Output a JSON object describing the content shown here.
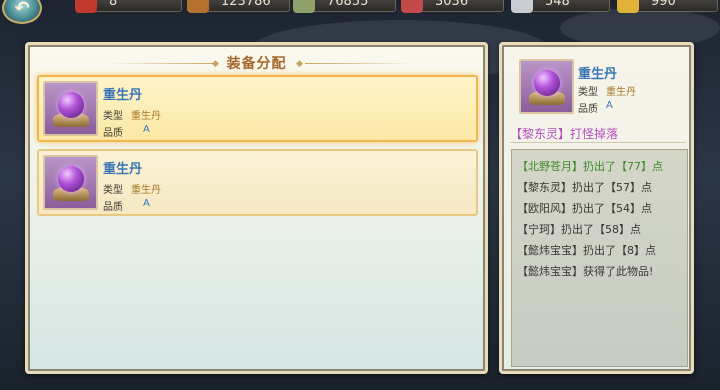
{
  "resources": [
    {
      "icon": "flame-token-icon",
      "value": "8",
      "color": "#c0392b"
    },
    {
      "icon": "wood-icon",
      "value": "123786",
      "color": "#b5722e"
    },
    {
      "icon": "cash-icon",
      "value": "76855",
      "color": "#8fa06a"
    },
    {
      "icon": "meat-icon",
      "value": "3036",
      "color": "#c44a4a"
    },
    {
      "icon": "silver-icon",
      "value": "548",
      "color": "#c9ccd0"
    },
    {
      "icon": "gold-icon",
      "value": "990",
      "color": "#e0b23a"
    }
  ],
  "back_button": {
    "glyph": "↶"
  },
  "panel": {
    "title": "装备分配"
  },
  "items": [
    {
      "name": "重生丹",
      "type_label": "类型",
      "type_value": "重生丹",
      "quality_label": "品质",
      "quality_value": "A"
    },
    {
      "name": "重生丹",
      "type_label": "类型",
      "type_value": "重生丹",
      "quality_label": "品质",
      "quality_value": "A"
    }
  ],
  "detail": {
    "name": "重生丹",
    "type_label": "类型",
    "type_value": "重生丹",
    "quality_label": "品质",
    "quality_value": "A",
    "drop_source": "【黎东灵】打怪掉落"
  },
  "roll_log": [
    "【北野苍月】扔出了【77】点",
    "【黎东灵】扔出了【57】点",
    "【欧阳风】扔出了【54】点",
    "【宁珂】扔出了【58】点",
    "【懿炜宝宝】扔出了【8】点",
    "【懿炜宝宝】获得了此物品!"
  ],
  "colors": {
    "accent": "#a5682a",
    "item_name": "#3b77b8",
    "drop_source": "#b14fbf",
    "winner_roll": "#3f8a2c"
  }
}
